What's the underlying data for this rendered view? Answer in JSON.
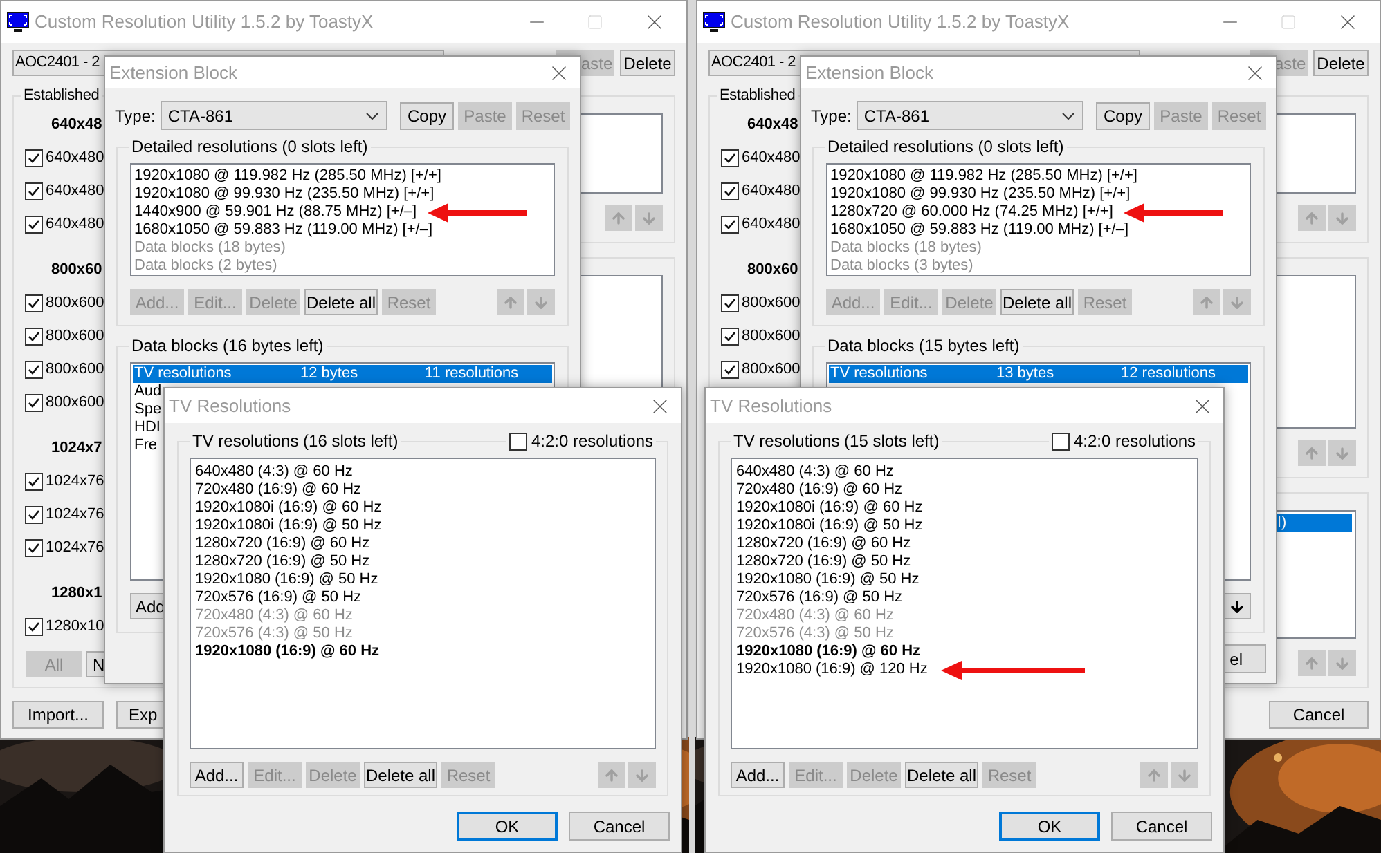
{
  "panels": [
    {
      "main_window": {
        "title": "Custom Resolution Utility 1.5.2 by ToastyX",
        "device": "AOC2401 - 2",
        "top_buttons": [
          {
            "label": "aste",
            "disabled": true
          },
          {
            "label": "Delete",
            "disabled": false
          }
        ],
        "established_label": "Established",
        "resolution_groups": [
          {
            "heading": "640x48",
            "items": [
              {
                "label": "640x480",
                "checked": true
              },
              {
                "label": "640x480",
                "checked": true
              },
              {
                "label": "640x480",
                "checked": true
              }
            ]
          },
          {
            "heading": "800x60",
            "items": [
              {
                "label": "800x600",
                "checked": true
              },
              {
                "label": "800x600",
                "checked": true
              },
              {
                "label": "800x600",
                "checked": true
              },
              {
                "label": "800x600",
                "checked": true
              }
            ]
          },
          {
            "heading": "1024x7",
            "items": [
              {
                "label": "1024x76",
                "checked": true
              },
              {
                "label": "1024x76",
                "checked": true
              },
              {
                "label": "1024x76",
                "checked": true
              }
            ]
          },
          {
            "heading": "1280x1",
            "items": [
              {
                "label": "1280x10",
                "checked": true
              }
            ]
          }
        ],
        "group_buttons": [
          {
            "label": "All",
            "disabled": true
          },
          {
            "label": "N",
            "disabled": false
          }
        ],
        "side_lists": [
          {
            "arrows": [
              {
                "kind": "up",
                "disabled": true
              },
              {
                "kind": "down",
                "disabled": true
              }
            ]
          }
        ],
        "bottom_left_buttons": [
          "Import...",
          "Exp"
        ]
      },
      "extension_block": {
        "title": "Extension Block",
        "type_label": "Type:",
        "type_value": "CTA-861",
        "buttons": [
          {
            "label": "Copy",
            "disabled": false
          },
          {
            "label": "Paste",
            "disabled": true
          },
          {
            "label": "Reset",
            "disabled": true
          }
        ],
        "detailed": {
          "label": "Detailed resolutions (0 slots left)",
          "items": [
            {
              "text": "1920x1080 @ 119.982 Hz (285.50 MHz) [+/+]",
              "kind": "normal",
              "highlighted": false
            },
            {
              "text": "1920x1080 @ 99.930 Hz (235.50 MHz) [+/+]",
              "kind": "normal",
              "highlighted": false
            },
            {
              "text": "1440x900 @ 59.901 Hz (88.75 MHz) [+/–]",
              "kind": "normal",
              "highlighted": true
            },
            {
              "text": "1680x1050 @ 59.883 Hz (119.00 MHz) [+/–]",
              "kind": "normal",
              "highlighted": false
            },
            {
              "text": "Data blocks (18 bytes)",
              "kind": "inactive",
              "highlighted": false
            },
            {
              "text": "Data blocks (2 bytes)",
              "kind": "inactive",
              "highlighted": false
            }
          ],
          "buttons": [
            {
              "label": "Add...",
              "disabled": true
            },
            {
              "label": "Edit...",
              "disabled": true
            },
            {
              "label": "Delete",
              "disabled": true
            },
            {
              "label": "Delete all",
              "disabled": false
            },
            {
              "label": "Reset",
              "disabled": true
            }
          ],
          "arrows": [
            {
              "kind": "up",
              "disabled": true
            },
            {
              "kind": "down",
              "disabled": true
            }
          ]
        },
        "data_blocks": {
          "label": "Data blocks (16 bytes left)",
          "rows": [
            {
              "cells": [
                "TV resolutions",
                "12 bytes",
                "11 resolutions"
              ],
              "selected": true
            },
            {
              "cells": [
                "Aud"
              ],
              "selected": false
            },
            {
              "cells": [
                "Spe"
              ],
              "selected": false
            },
            {
              "cells": [
                "HDI"
              ],
              "selected": false
            },
            {
              "cells": [
                "Fre"
              ],
              "selected": false
            }
          ],
          "buttons": [
            {
              "label": "Add",
              "disabled": false
            }
          ]
        }
      },
      "tv_resolutions": {
        "title": "TV Resolutions",
        "group_label": "TV resolutions (16 slots left)",
        "option": {
          "label": "4:2:0 resolutions",
          "checked": false
        },
        "items": [
          {
            "text": "640x480 (4:3) @ 60 Hz",
            "kind": "normal",
            "highlighted": false
          },
          {
            "text": "720x480 (16:9) @ 60 Hz",
            "kind": "normal",
            "highlighted": false
          },
          {
            "text": "1920x1080i (16:9) @ 60 Hz",
            "kind": "normal",
            "highlighted": false
          },
          {
            "text": "1920x1080i (16:9) @ 50 Hz",
            "kind": "normal",
            "highlighted": false
          },
          {
            "text": "1280x720 (16:9) @ 60 Hz",
            "kind": "normal",
            "highlighted": false
          },
          {
            "text": "1280x720 (16:9) @ 50 Hz",
            "kind": "normal",
            "highlighted": false
          },
          {
            "text": "1920x1080 (16:9) @ 50 Hz",
            "kind": "normal",
            "highlighted": false
          },
          {
            "text": "720x576 (16:9) @ 50 Hz",
            "kind": "normal",
            "highlighted": false
          },
          {
            "text": "720x480 (4:3) @ 60 Hz",
            "kind": "inactive",
            "highlighted": false
          },
          {
            "text": "720x576 (4:3) @ 50 Hz",
            "kind": "inactive",
            "highlighted": false
          },
          {
            "text": "1920x1080 (16:9) @ 60 Hz",
            "kind": "native",
            "highlighted": false
          }
        ],
        "buttons": [
          {
            "label": "Add...",
            "disabled": false
          },
          {
            "label": "Edit...",
            "disabled": true
          },
          {
            "label": "Delete",
            "disabled": true
          },
          {
            "label": "Delete all",
            "disabled": false
          },
          {
            "label": "Reset",
            "disabled": true
          }
        ],
        "arrows": [
          {
            "kind": "up",
            "disabled": true
          },
          {
            "kind": "down",
            "disabled": true
          }
        ],
        "dialog_buttons": [
          {
            "label": "OK",
            "default": true
          },
          {
            "label": "Cancel",
            "default": false
          }
        ]
      }
    },
    {
      "main_window": {
        "title": "Custom Resolution Utility 1.5.2 by ToastyX",
        "device": "AOC2401 - 2",
        "top_buttons": [
          {
            "label": "aste",
            "disabled": true
          },
          {
            "label": "Delete",
            "disabled": false
          }
        ],
        "established_label": "Established",
        "resolution_groups": [
          {
            "heading": "640x48",
            "items": [
              {
                "label": "640x480",
                "checked": true
              },
              {
                "label": "640x480",
                "checked": true
              },
              {
                "label": "640x480",
                "checked": true
              }
            ]
          },
          {
            "heading": "800x60",
            "items": [
              {
                "label": "800x600",
                "checked": true
              },
              {
                "label": "800x600",
                "checked": true
              },
              {
                "label": "800x600",
                "checked": true
              }
            ]
          }
        ],
        "side_lists": [
          {
            "arrows": [
              {
                "kind": "up",
                "disabled": true
              },
              {
                "kind": "down",
                "disabled": true
              }
            ]
          },
          {
            "arrows": [
              {
                "kind": "up",
                "disabled": true
              },
              {
                "kind": "down",
                "disabled": true
              }
            ]
          },
          {
            "items": [
              {
                "text": "I)",
                "selected": true
              }
            ],
            "arrows": [
              {
                "kind": "up",
                "disabled": true
              },
              {
                "kind": "down",
                "disabled": true
              }
            ]
          }
        ],
        "bottom_right_buttons": [
          "Cancel"
        ]
      },
      "extension_block": {
        "title": "Extension Block",
        "type_label": "Type:",
        "type_value": "CTA-861",
        "buttons": [
          {
            "label": "Copy",
            "disabled": false
          },
          {
            "label": "Paste",
            "disabled": true
          },
          {
            "label": "Reset",
            "disabled": true
          }
        ],
        "detailed": {
          "label": "Detailed resolutions (0 slots left)",
          "items": [
            {
              "text": "1920x1080 @ 119.982 Hz (285.50 MHz) [+/+]",
              "kind": "normal",
              "highlighted": false
            },
            {
              "text": "1920x1080 @ 99.930 Hz (235.50 MHz) [+/+]",
              "kind": "normal",
              "highlighted": false
            },
            {
              "text": "1280x720 @ 60.000 Hz (74.25 MHz) [+/+]",
              "kind": "normal",
              "highlighted": true
            },
            {
              "text": "1680x1050 @ 59.883 Hz (119.00 MHz) [+/–]",
              "kind": "normal",
              "highlighted": false
            },
            {
              "text": "Data blocks (18 bytes)",
              "kind": "inactive",
              "highlighted": false
            },
            {
              "text": "Data blocks (3 bytes)",
              "kind": "inactive",
              "highlighted": false
            }
          ],
          "buttons": [
            {
              "label": "Add...",
              "disabled": true
            },
            {
              "label": "Edit...",
              "disabled": true
            },
            {
              "label": "Delete",
              "disabled": true
            },
            {
              "label": "Delete all",
              "disabled": false
            },
            {
              "label": "Reset",
              "disabled": true
            }
          ],
          "arrows": [
            {
              "kind": "up",
              "disabled": true
            },
            {
              "kind": "down",
              "disabled": true
            }
          ]
        },
        "data_blocks": {
          "label": "Data blocks (15 bytes left)",
          "rows": [
            {
              "cells": [
                "TV resolutions",
                "13 bytes",
                "12 resolutions"
              ],
              "selected": true
            }
          ],
          "arrows": [
            {
              "kind": "down",
              "disabled": false
            }
          ]
        },
        "footer_buttons": [
          "el"
        ]
      },
      "tv_resolutions": {
        "title": "TV Resolutions",
        "group_label": "TV resolutions (15 slots left)",
        "option": {
          "label": "4:2:0 resolutions",
          "checked": false
        },
        "items": [
          {
            "text": "640x480 (4:3) @ 60 Hz",
            "kind": "normal",
            "highlighted": false
          },
          {
            "text": "720x480 (16:9) @ 60 Hz",
            "kind": "normal",
            "highlighted": false
          },
          {
            "text": "1920x1080i (16:9) @ 60 Hz",
            "kind": "normal",
            "highlighted": false
          },
          {
            "text": "1920x1080i (16:9) @ 50 Hz",
            "kind": "normal",
            "highlighted": false
          },
          {
            "text": "1280x720 (16:9) @ 60 Hz",
            "kind": "normal",
            "highlighted": false
          },
          {
            "text": "1280x720 (16:9) @ 50 Hz",
            "kind": "normal",
            "highlighted": false
          },
          {
            "text": "1920x1080 (16:9) @ 50 Hz",
            "kind": "normal",
            "highlighted": false
          },
          {
            "text": "720x576 (16:9) @ 50 Hz",
            "kind": "normal",
            "highlighted": false
          },
          {
            "text": "720x480 (4:3) @ 60 Hz",
            "kind": "inactive",
            "highlighted": false
          },
          {
            "text": "720x576 (4:3) @ 50 Hz",
            "kind": "inactive",
            "highlighted": false
          },
          {
            "text": "1920x1080 (16:9) @ 60 Hz",
            "kind": "native",
            "highlighted": false
          },
          {
            "text": "1920x1080 (16:9) @ 120 Hz",
            "kind": "normal",
            "highlighted": true
          }
        ],
        "buttons": [
          {
            "label": "Add...",
            "disabled": false
          },
          {
            "label": "Edit...",
            "disabled": true
          },
          {
            "label": "Delete",
            "disabled": true
          },
          {
            "label": "Delete all",
            "disabled": false
          },
          {
            "label": "Reset",
            "disabled": true
          }
        ],
        "arrows": [
          {
            "kind": "up",
            "disabled": true
          },
          {
            "kind": "down",
            "disabled": true
          }
        ],
        "dialog_buttons": [
          {
            "label": "OK",
            "default": true
          },
          {
            "label": "Cancel",
            "default": false
          }
        ]
      }
    }
  ]
}
